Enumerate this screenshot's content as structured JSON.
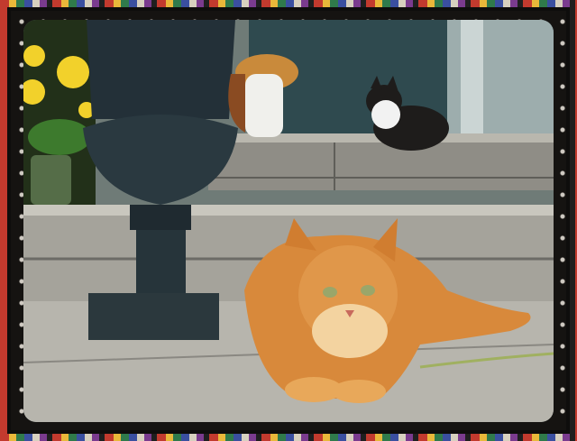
{
  "photo": {
    "subject": "",
    "colors": {
      "door_teal": "#2f4a4f",
      "stone_light": "#b9b7ae",
      "stone_mid": "#8f8d86",
      "stone_dark": "#5f5e59",
      "urn_iron": "#233038",
      "flowers_yellow": "#f2d12b",
      "leaves_green": "#3d7a2d",
      "cat_orange": "#d8893b",
      "cat_cream": "#f3d3a0",
      "tux_black": "#1e1c1b",
      "tux_white": "#f2f2f2",
      "frame_black": "#0e0d0c"
    }
  }
}
